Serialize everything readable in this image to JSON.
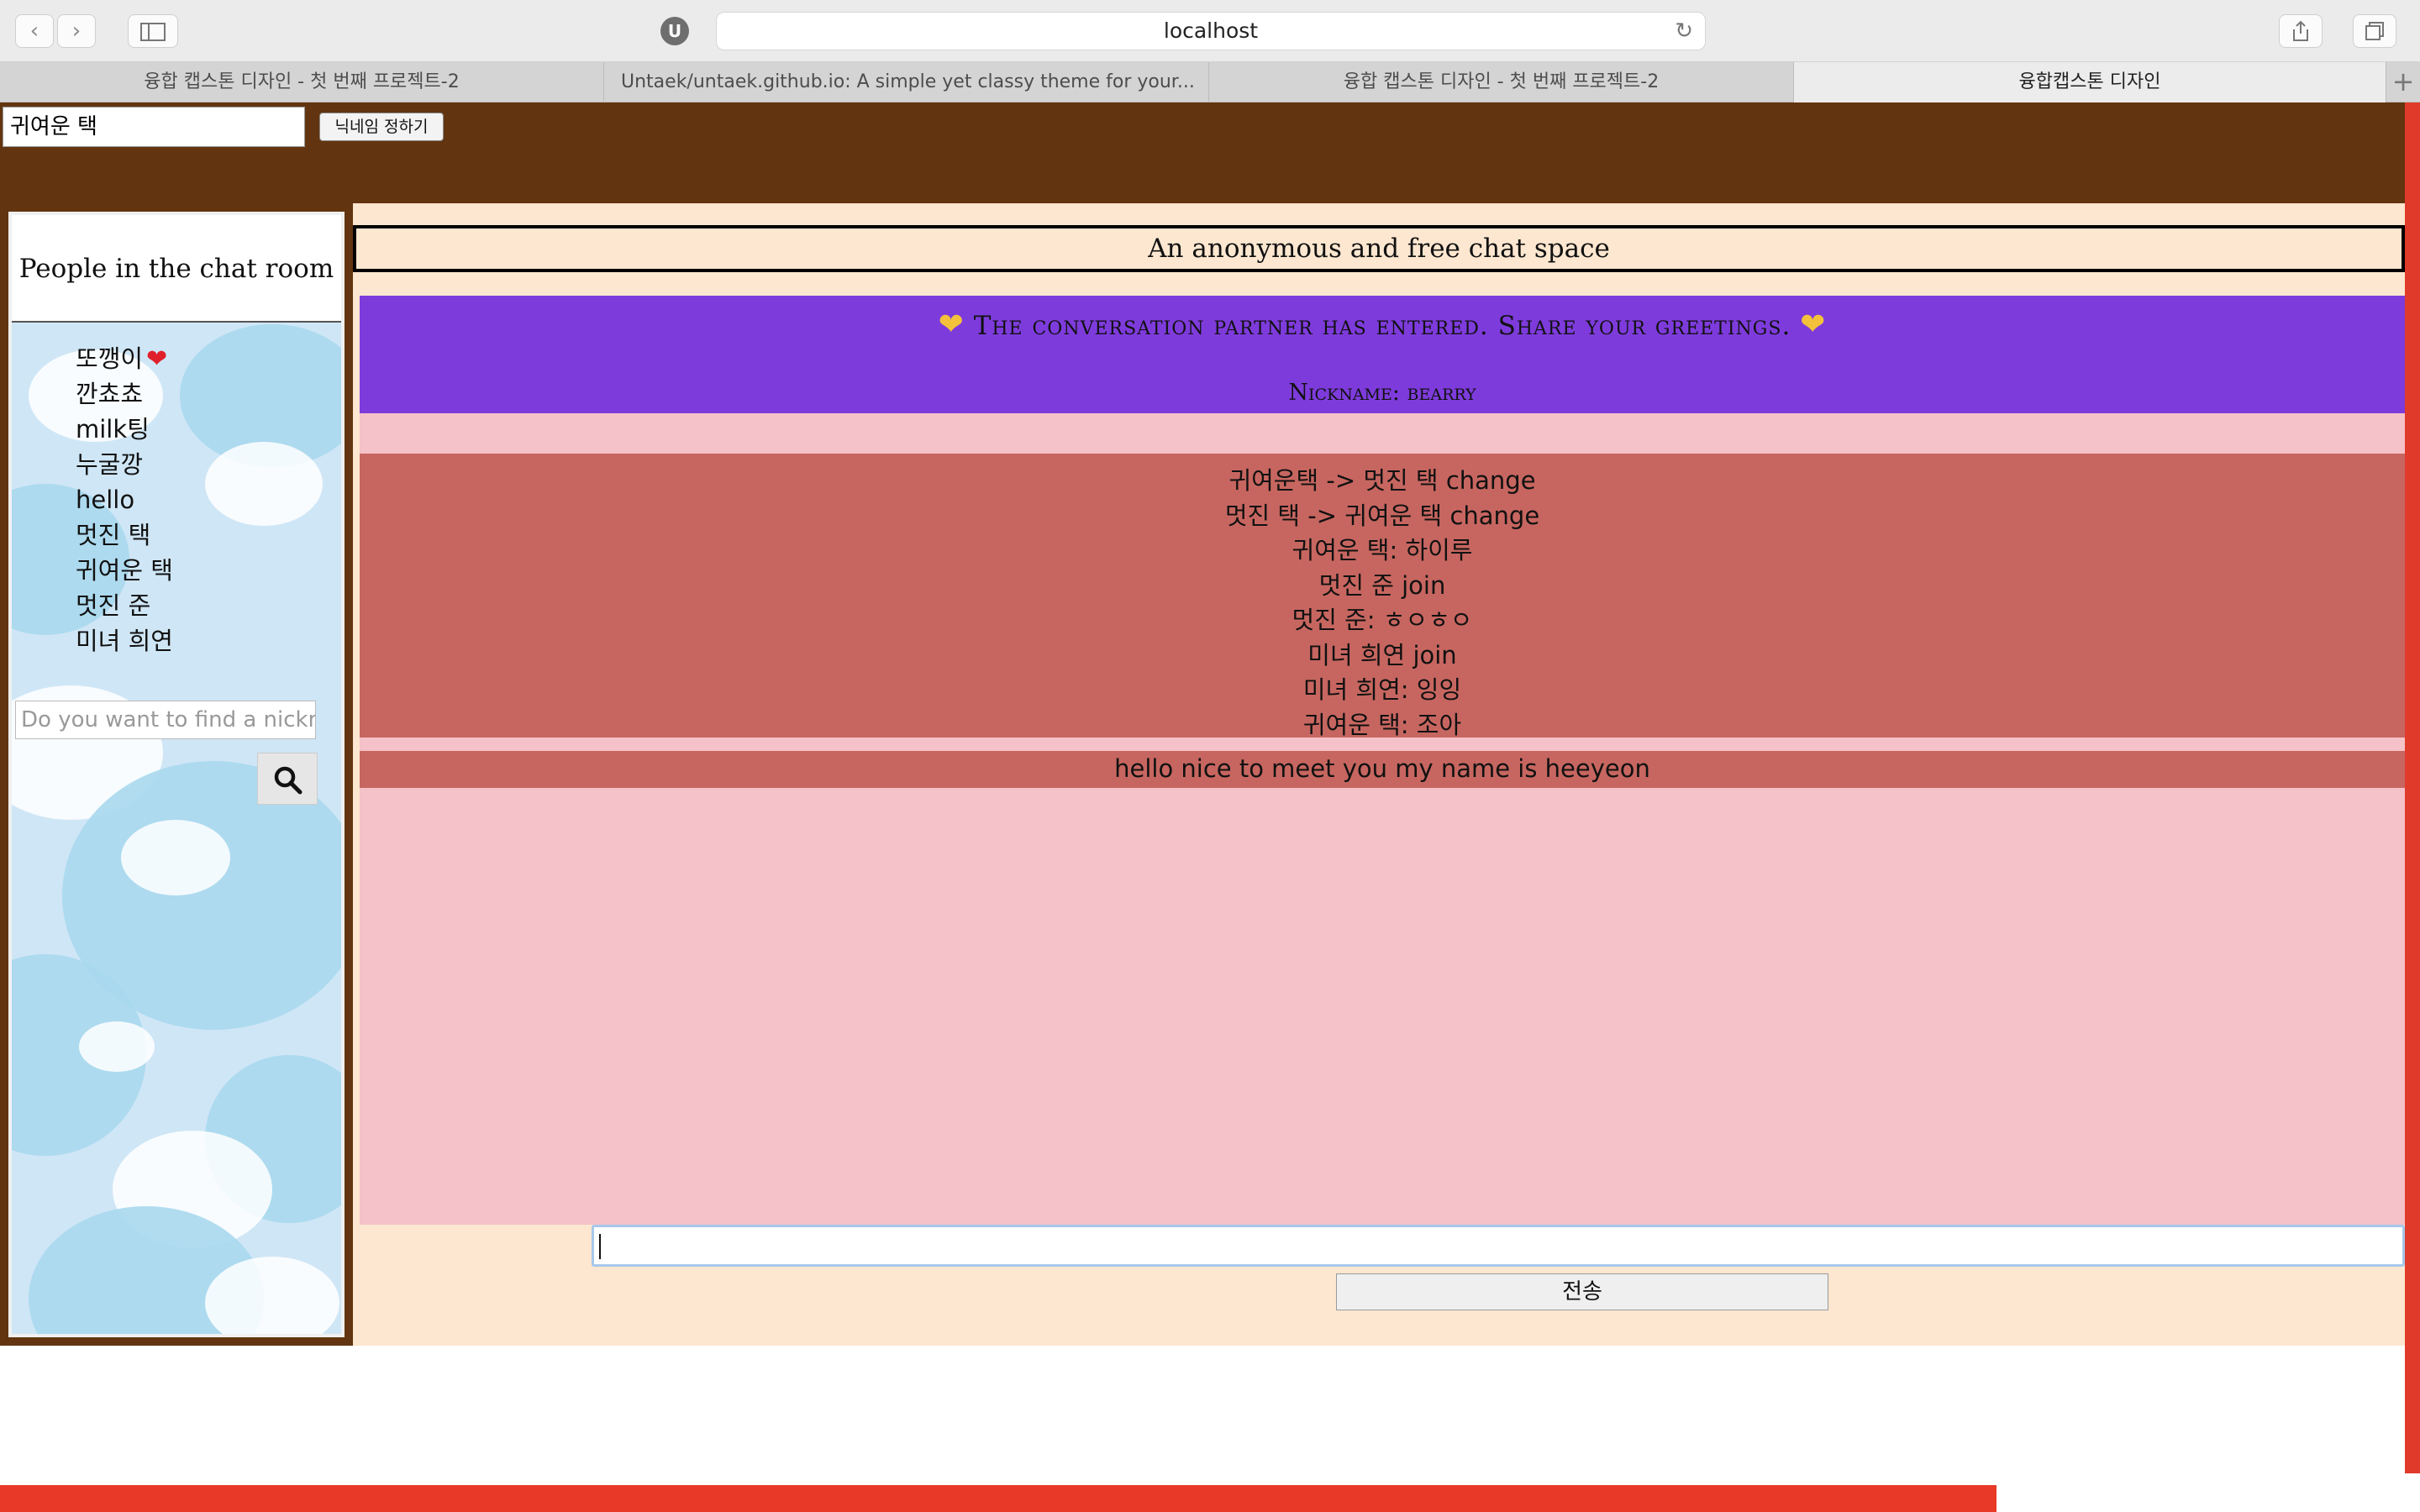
{
  "browser": {
    "url": "localhost",
    "tabs": [
      {
        "label": "융합 캡스톤 디자인 - 첫 번째 프로젝트-2",
        "active": false
      },
      {
        "label": "Untaek/untaek.github.io: A simple yet classy theme for your...",
        "active": false
      },
      {
        "label": "융합 캡스톤 디자인 - 첫 번째 프로젝트-2",
        "active": false
      },
      {
        "label": "융합캡스톤 디자인",
        "active": true
      }
    ],
    "shield_label": "U"
  },
  "header": {
    "nickname_value": "귀여운 택",
    "nickname_button": "닉네임 정하기"
  },
  "sidebar": {
    "title": "People in the chat room",
    "users": [
      "또깽이",
      "깐쵸쵸",
      "milk팅",
      "누굴깡",
      "hello",
      "멋진 택",
      "귀여운 택",
      "멋진 준",
      "미녀 희연"
    ],
    "find_placeholder": "Do you want to find a nickname?"
  },
  "chat": {
    "title": "An anonymous and free chat space",
    "entered_notice": "The conversation partner has entered. Share your greetings.",
    "partner_nickname": "Nickname: bearry",
    "log": [
      "귀여운택 -> 멋진 택 change",
      "멋진 택 -> 귀여운 택 change",
      "귀여운 택: 하이루",
      "멋진 준 join",
      "멋진 준: ㅎㅇㅎㅇ",
      "미녀 희연 join",
      "미녀 희연: 잉잉",
      "귀여운 택: 조아"
    ],
    "last_message": "hello nice to meet you my name is heeyeon",
    "send_button": "전송"
  },
  "colors": {
    "header_brown": "#623510",
    "chat_peach": "#fde7d0",
    "chat_pink": "#f4c2c8",
    "notice_purple": "#7e3bdc",
    "log_red": "#c76660",
    "accent_red": "#e83828"
  }
}
